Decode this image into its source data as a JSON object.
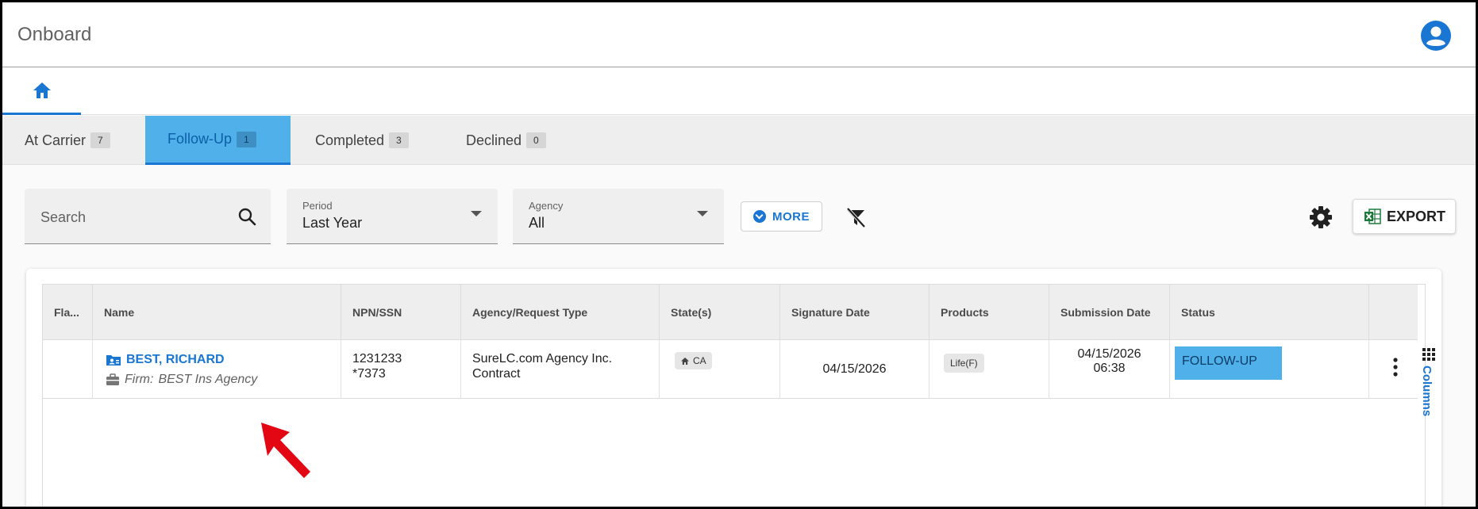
{
  "app": {
    "title": "Onboard"
  },
  "tabs": [
    {
      "label": "At Carrier",
      "count": "7"
    },
    {
      "label": "Follow-Up",
      "count": "1"
    },
    {
      "label": "Completed",
      "count": "3"
    },
    {
      "label": "Declined",
      "count": "0"
    }
  ],
  "filters": {
    "search_placeholder": "Search",
    "period_label": "Period",
    "period_value": "Last Year",
    "agency_label": "Agency",
    "agency_value": "All",
    "more_label": "MORE",
    "export_label": "EXPORT"
  },
  "grid": {
    "columns": [
      "Fla...",
      "Name",
      "NPN/SSN",
      "Agency/Request Type",
      "State(s)",
      "Signature Date",
      "Products",
      "Submission Date",
      "Status"
    ],
    "rows": [
      {
        "name": "BEST, RICHARD",
        "firm_prefix": "Firm:",
        "firm": "BEST Ins Agency",
        "npn": "1231233",
        "ssn": "*7373",
        "agency_line1": "SureLC.com Agency Inc.",
        "agency_line2": "Contract",
        "state": "CA",
        "signature_date": "04/15/2026",
        "product": "Life(F)",
        "submission_date": "04/15/2026",
        "submission_time": "06:38",
        "status": "FOLLOW-UP"
      }
    ],
    "columns_panel_label": "Columns"
  },
  "colors": {
    "accent": "#1976d2",
    "active_tab": "#4fb0ea",
    "annotation_arrow": "#e30613"
  }
}
